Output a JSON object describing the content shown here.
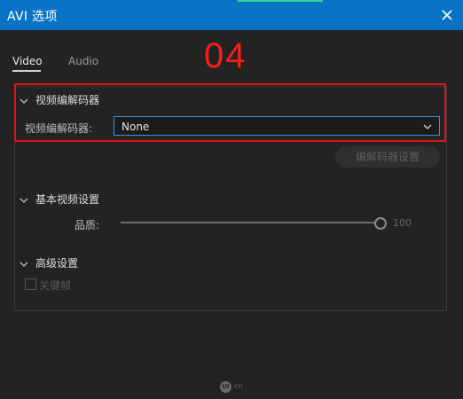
{
  "window": {
    "title": "AVI 选项"
  },
  "step_label": "04",
  "tabs": [
    {
      "label": "Video",
      "active": true
    },
    {
      "label": "Audio",
      "active": false
    }
  ],
  "codec_section": {
    "header": "视频编解码器",
    "field_label": "视频编解码器:",
    "selected_value": "None",
    "settings_button": "编解码器设置"
  },
  "basic_section": {
    "header": "基本视频设置",
    "quality_label": "品质:",
    "quality_value": "100"
  },
  "advanced_section": {
    "header": "高级设置",
    "keyframe_label": "关键帧",
    "keyframe_checked": false
  },
  "watermark": {
    "logo": "UI",
    "suffix": "cn"
  },
  "colors": {
    "titlebar": "#0a73c6",
    "background": "#232323",
    "highlight": "#e0151b",
    "select_border": "#3c8fd8"
  },
  "icons": {
    "close": "close-icon",
    "expand": "chevron-down-icon",
    "dropdown": "chevron-down-icon"
  }
}
